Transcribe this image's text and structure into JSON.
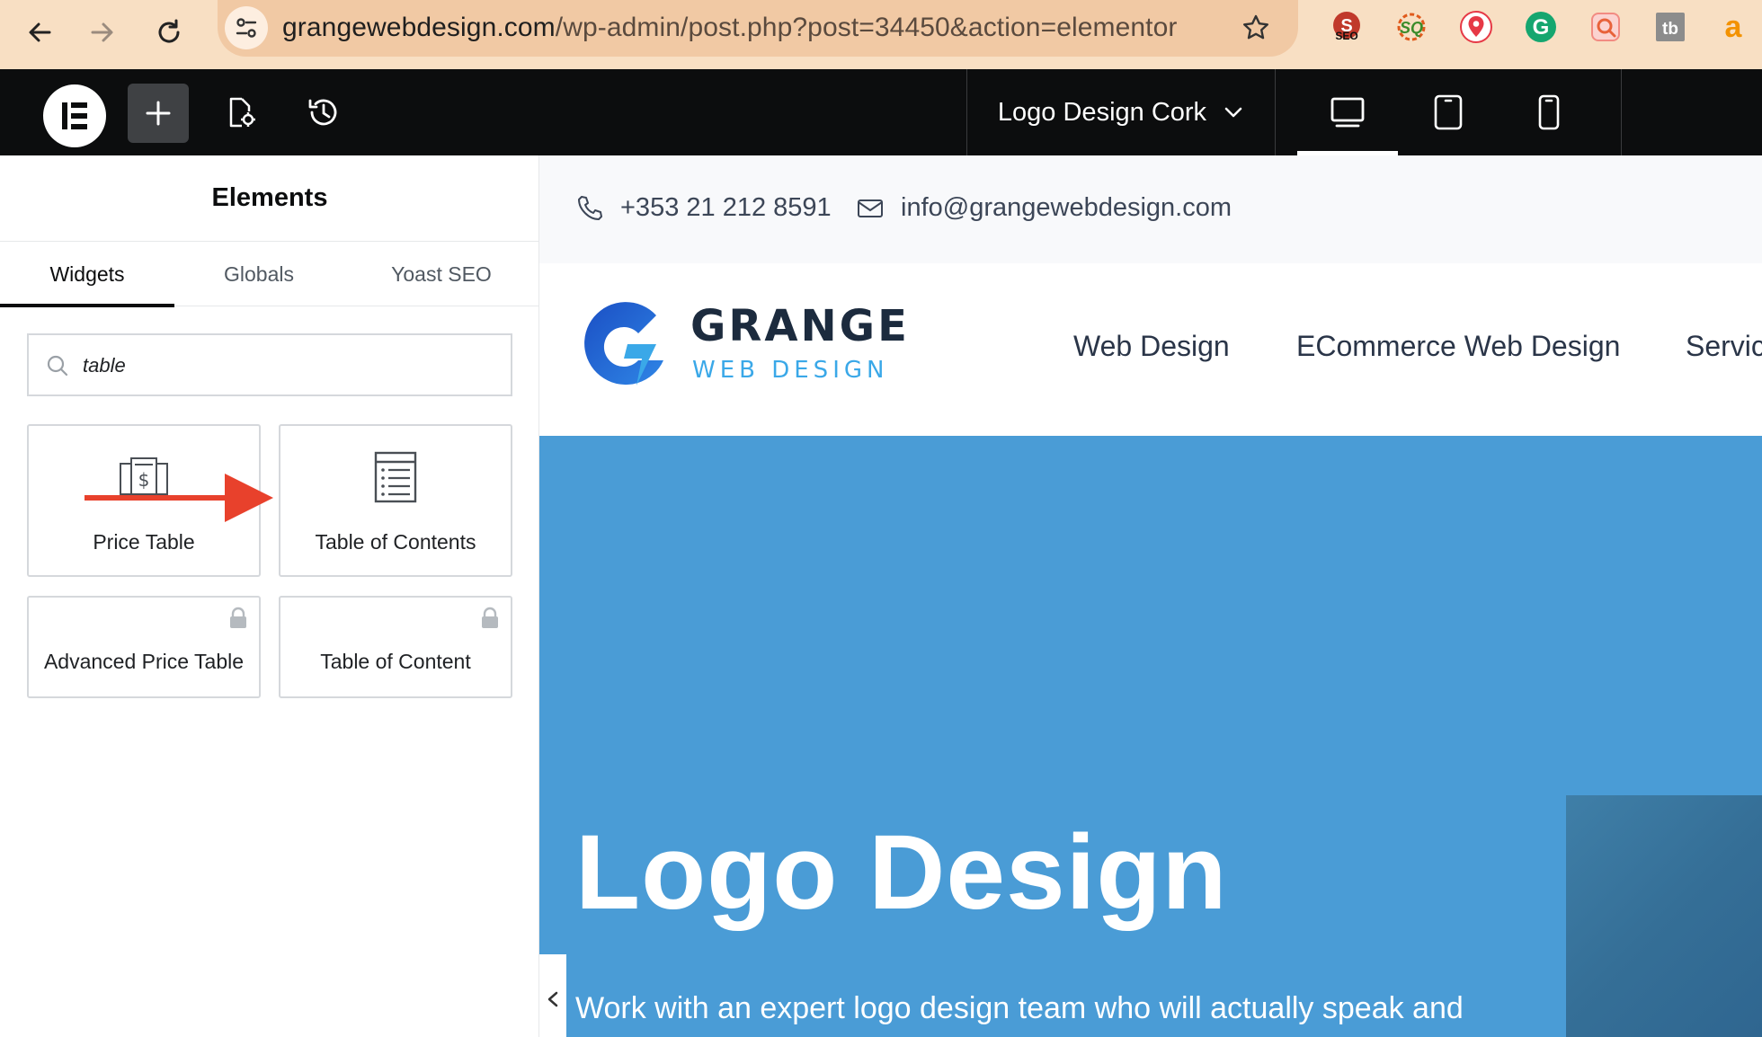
{
  "browser": {
    "url_domain": "grangewebdesign.com",
    "url_path": "/wp-admin/post.php?post=34450&action=elementor",
    "extensions": [
      {
        "name": "seo-extension-icon",
        "label": "SEO",
        "color": "#c0392b"
      },
      {
        "name": "sq-extension-icon",
        "label": "SQ",
        "color": "#e05a1c"
      },
      {
        "name": "location-extension-icon",
        "label": "",
        "color": "#e63946"
      },
      {
        "name": "grammarly-extension-icon",
        "label": "G",
        "color": "#15a66f"
      },
      {
        "name": "search-extension-icon",
        "label": "",
        "color": "#f28b82"
      },
      {
        "name": "tb-extension-icon",
        "label": "tb",
        "color": "#8c8c8c"
      },
      {
        "name": "amazon-extension-icon",
        "label": "a",
        "color": "#f39200"
      }
    ]
  },
  "editor": {
    "page_name": "Logo Design Cork",
    "device_active": "desktop"
  },
  "panel": {
    "title": "Elements",
    "tabs": [
      "Widgets",
      "Globals",
      "Yoast SEO"
    ],
    "search_value": "table",
    "widgets": [
      {
        "label": "Price Table",
        "locked": false
      },
      {
        "label": "Table of Contents",
        "locked": false
      },
      {
        "label": "Advanced Price Table",
        "locked": true
      },
      {
        "label": "Table of Content",
        "locked": true
      }
    ]
  },
  "site": {
    "phone": "+353 21 212 8591",
    "email": "info@grangewebdesign.com",
    "logo_main": "GRANGE",
    "logo_sub": "WEB DESIGN",
    "menu": [
      "Web Design",
      "ECommerce Web Design",
      "Servic"
    ],
    "hero_title": "Logo Design",
    "hero_subtitle": "Work with an expert logo design team who will actually speak and",
    "hero_color": "#4a9cd6"
  },
  "colors": {
    "browser_bar": "#f8dfc3",
    "editor_bar": "#0c0d0e",
    "annotation_arrow": "#e8412c"
  }
}
